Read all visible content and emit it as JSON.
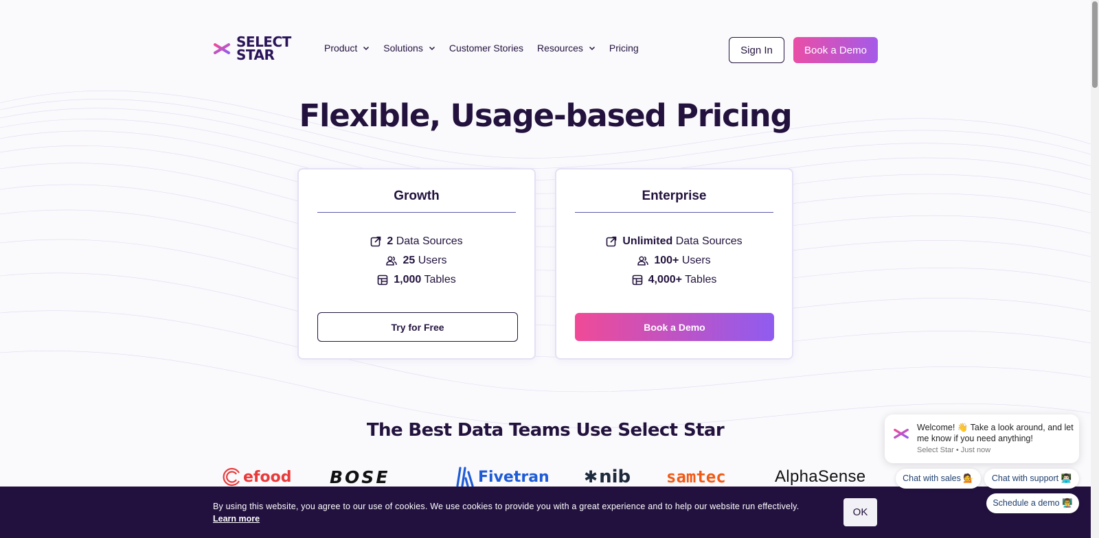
{
  "brand": {
    "name_line1": "SELECT",
    "name_line2": "STAR"
  },
  "nav": {
    "items": [
      {
        "label": "Product",
        "has_dropdown": true
      },
      {
        "label": "Solutions",
        "has_dropdown": true
      },
      {
        "label": "Customer Stories",
        "has_dropdown": false
      },
      {
        "label": "Resources",
        "has_dropdown": true
      },
      {
        "label": "Pricing",
        "has_dropdown": false
      }
    ],
    "sign_in": "Sign In",
    "book_demo": "Book a Demo"
  },
  "hero": {
    "title": "Flexible, Usage-based Pricing"
  },
  "plans": [
    {
      "name": "Growth",
      "features": [
        {
          "icon": "external-link-icon",
          "value": "2",
          "label": "Data Sources"
        },
        {
          "icon": "users-icon",
          "value": "25",
          "label": "Users"
        },
        {
          "icon": "table-icon",
          "value": "1,000",
          "label": "Tables"
        }
      ],
      "cta": "Try for Free"
    },
    {
      "name": "Enterprise",
      "features": [
        {
          "icon": "external-link-icon",
          "value": "Unlimited",
          "label": "Data Sources"
        },
        {
          "icon": "users-icon",
          "value": "100+",
          "label": "Users"
        },
        {
          "icon": "table-icon",
          "value": "4,000+",
          "label": "Tables"
        }
      ],
      "cta": "Book a Demo"
    }
  ],
  "customers": {
    "title": "The Best Data Teams Use Select Star",
    "logos": [
      "efood",
      "BOSE",
      "Fivetran",
      "nib",
      "samtec",
      "AlphaSense"
    ]
  },
  "cookie": {
    "text": "By using this website, you agree to our use of cookies. We use cookies to provide you with a great experience and to help our website run effectively.",
    "learn_more": "Learn more",
    "ok": "OK"
  },
  "chat": {
    "message": "Welcome! 👋 Take a look around, and let me know if you need anything!",
    "meta": "Select Star • Just now",
    "chips": [
      "Chat with sales 💁",
      "Chat with support 👨🏻‍💻",
      "Schedule a demo 👨‍🏫"
    ]
  },
  "colors": {
    "brand_dark": "#22123d",
    "accent_pink": "#e94ea6",
    "accent_purple": "#8f5cf0",
    "cookie_bg": "#22113f"
  }
}
